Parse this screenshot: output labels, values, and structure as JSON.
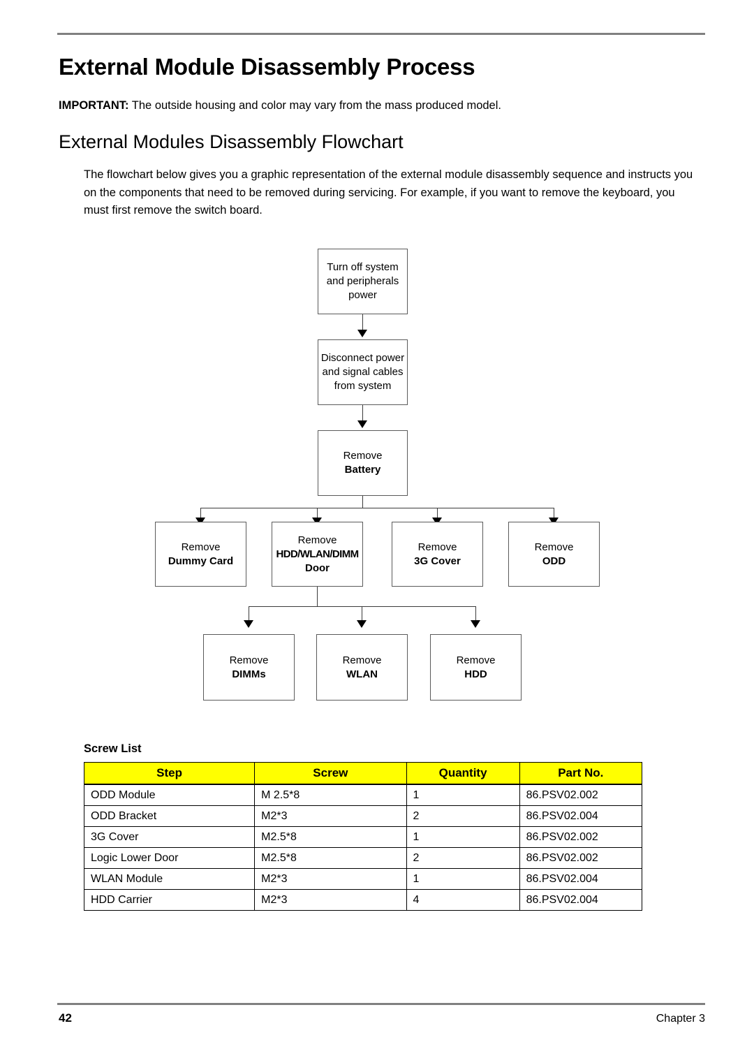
{
  "document": {
    "h1": "External Module Disassembly Process",
    "important_label": "IMPORTANT:",
    "important_text": " The outside housing and color may vary from the mass produced model.",
    "h2": "External Modules Disassembly Flowchart",
    "paragraph": "The flowchart below gives you a graphic representation of the external module disassembly sequence and instructs you on the components that need to be removed during servicing. For example, if you want to remove the keyboard, you must first remove the switch board."
  },
  "flowchart": {
    "nodes": {
      "power_off": {
        "line1": "Turn off system",
        "line2": "and peripherals",
        "line3": "power"
      },
      "disconnect": {
        "line1": "Disconnect power",
        "line2": "and signal cables",
        "line3": "from system"
      },
      "battery": {
        "line1": "Remove",
        "line2": "Battery"
      },
      "dummy_card": {
        "line1": "Remove",
        "line2": "Dummy Card"
      },
      "door": {
        "line1": "Remove",
        "line2": "HDD/WLAN/DIMM",
        "line3": "Door"
      },
      "cover_3g": {
        "line1": "Remove",
        "line2": "3G Cover"
      },
      "odd": {
        "line1": "Remove",
        "line2": "ODD"
      },
      "dimms": {
        "line1": "Remove",
        "line2": "DIMMs"
      },
      "wlan": {
        "line1": "Remove",
        "line2": "WLAN"
      },
      "hdd": {
        "line1": "Remove",
        "line2": "HDD"
      }
    }
  },
  "screw_list": {
    "title": "Screw List",
    "headers": [
      "Step",
      "Screw",
      "Quantity",
      "Part No."
    ],
    "rows": [
      {
        "step": "ODD Module",
        "screw": "M 2.5*8",
        "quantity": "1",
        "part_no": "86.PSV02.002"
      },
      {
        "step": "ODD Bracket",
        "screw": "M2*3",
        "quantity": "2",
        "part_no": "86.PSV02.004"
      },
      {
        "step": "3G Cover",
        "screw": "M2.5*8",
        "quantity": "1",
        "part_no": "86.PSV02.002"
      },
      {
        "step": "Logic Lower Door",
        "screw": "M2.5*8",
        "quantity": "2",
        "part_no": "86.PSV02.002"
      },
      {
        "step": "WLAN Module",
        "screw": "M2*3",
        "quantity": "1",
        "part_no": "86.PSV02.004"
      },
      {
        "step": "HDD Carrier",
        "screw": "M2*3",
        "quantity": "4",
        "part_no": "86.PSV02.004"
      }
    ]
  },
  "footer": {
    "page_number": "42",
    "chapter": "Chapter 3"
  },
  "colors": {
    "header_highlight": "#ffff00",
    "rule": "#808080",
    "box_border": "#5a5a5a"
  }
}
